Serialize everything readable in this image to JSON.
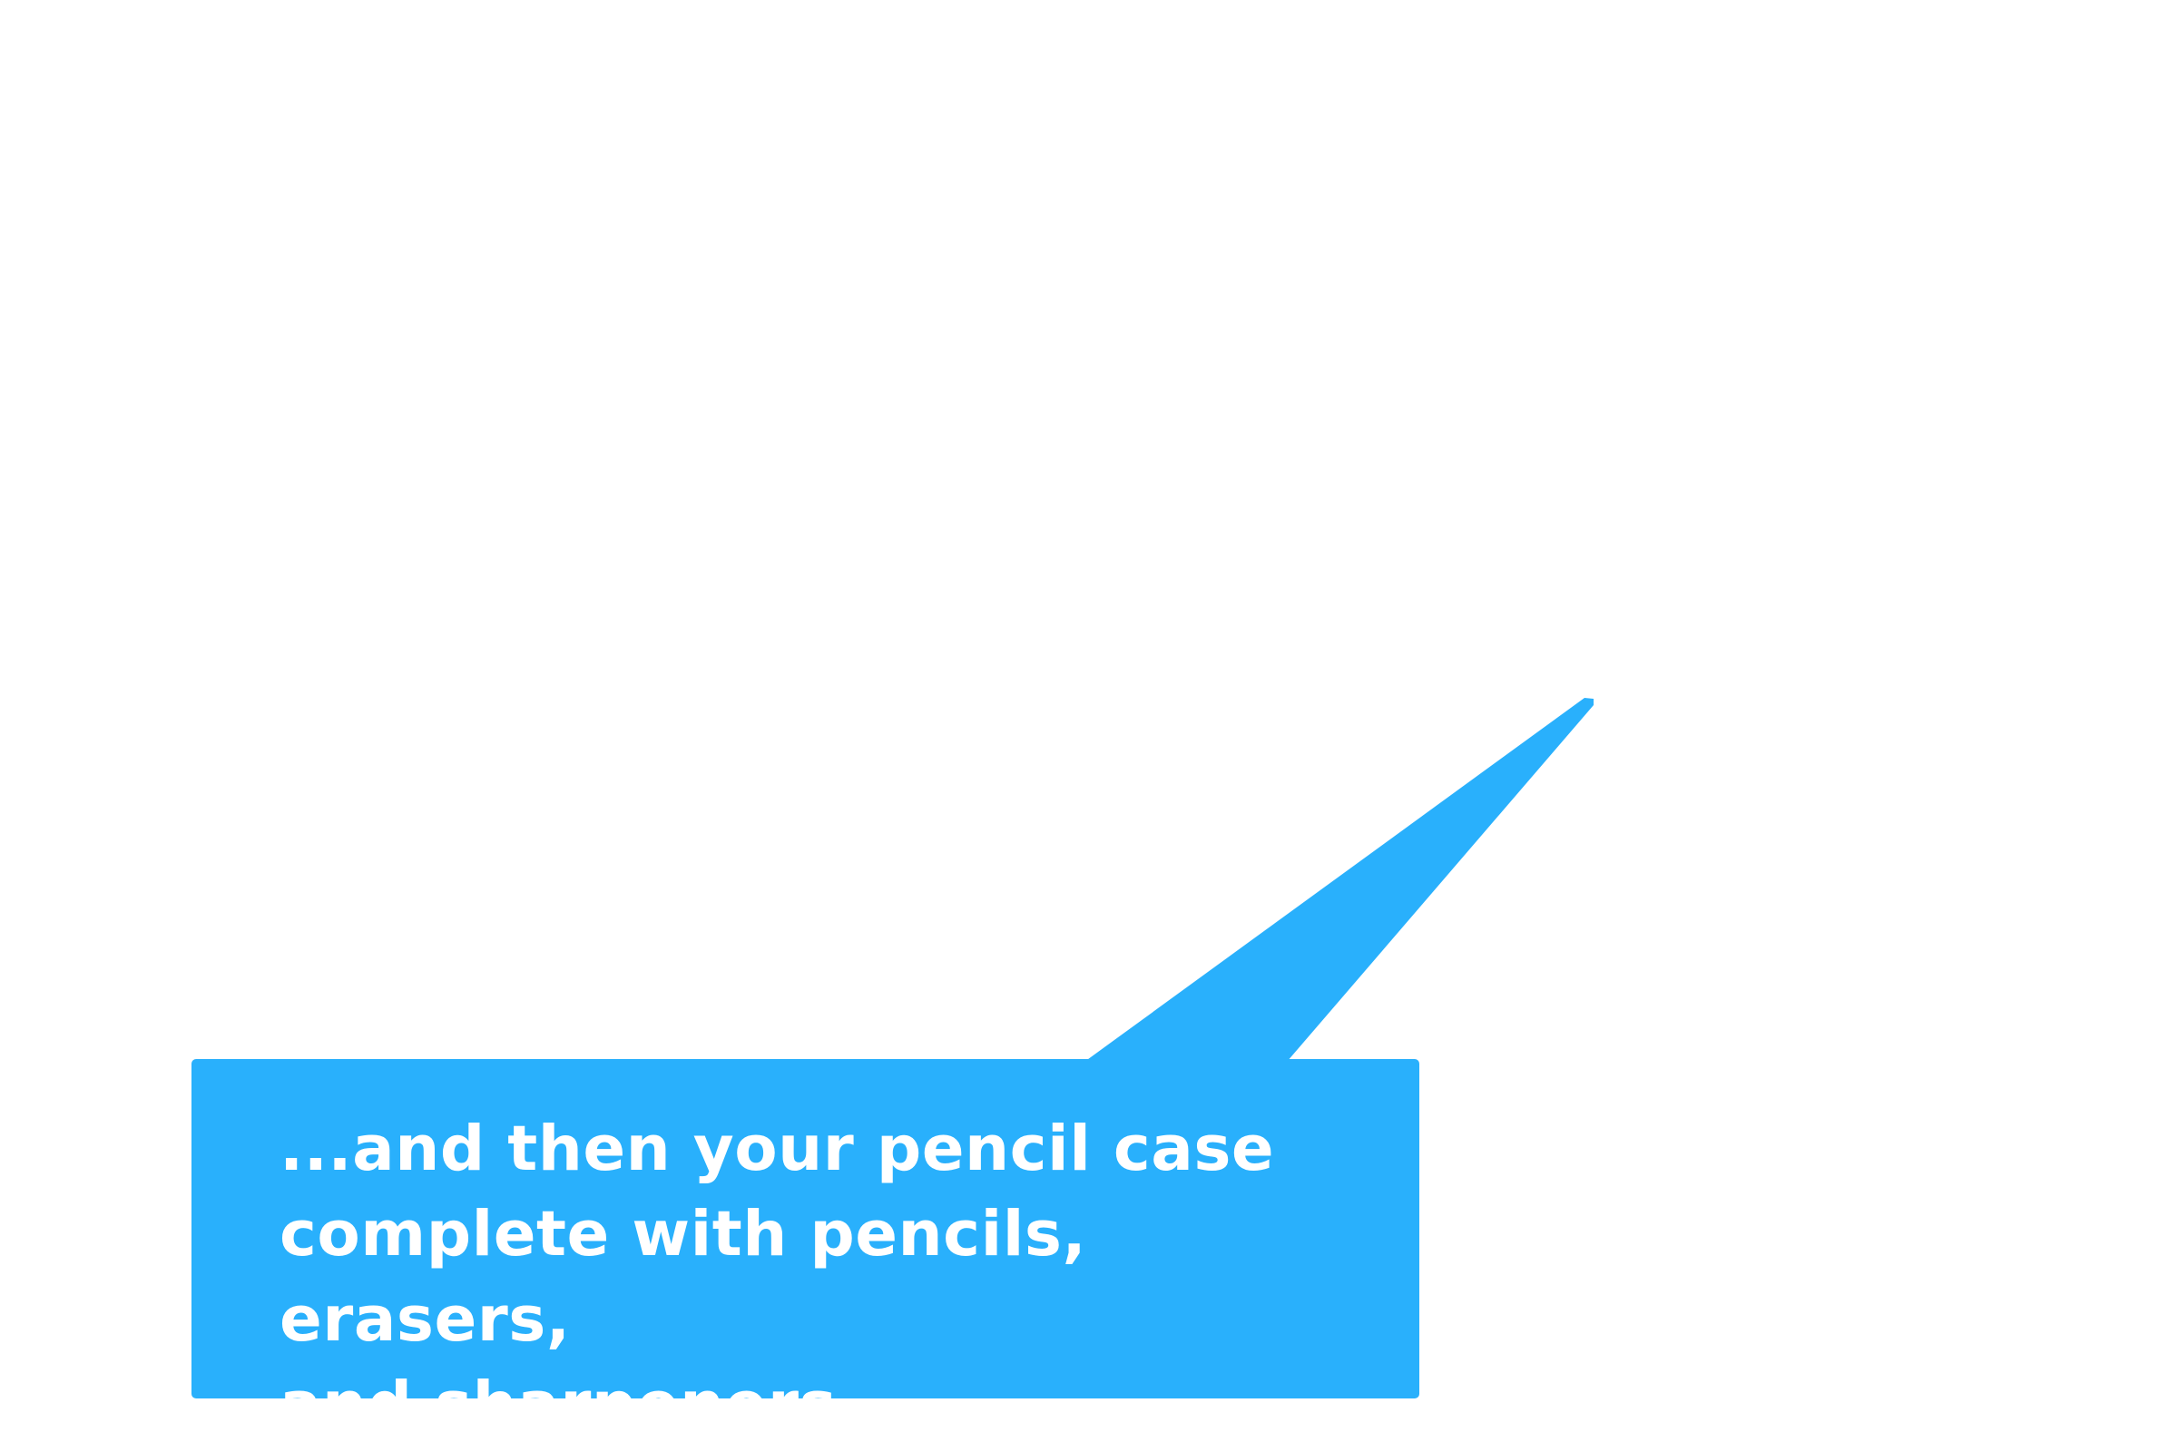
{
  "callout": {
    "text": "...and then your pencil case\ncomplete with pencils, erasers,\nand sharpeners...",
    "color": "#29b0fc",
    "text_color": "#ffffff"
  }
}
